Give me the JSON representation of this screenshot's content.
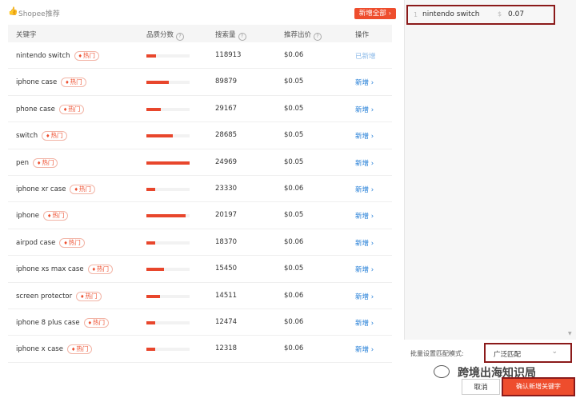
{
  "header": {
    "title": "Shopee推荐",
    "add_all_label": "新增全部",
    "add_all_chevron": "›"
  },
  "table": {
    "columns": [
      "关键字",
      "品质分数",
      "搜索量",
      "推荐出价",
      "操作"
    ],
    "hot_label": "热门",
    "rows": [
      {
        "keyword": "nintendo switch",
        "quality": 0.22,
        "volume": "118913",
        "bid": "$0.06",
        "action": "已新增",
        "added": true
      },
      {
        "keyword": "iphone case",
        "quality": 0.52,
        "volume": "89879",
        "bid": "$0.05",
        "action": "新增 ›",
        "added": false
      },
      {
        "keyword": "phone case",
        "quality": 0.33,
        "volume": "29167",
        "bid": "$0.05",
        "action": "新增 ›",
        "added": false
      },
      {
        "keyword": "switch",
        "quality": 0.62,
        "volume": "28685",
        "bid": "$0.05",
        "action": "新增 ›",
        "added": false
      },
      {
        "keyword": "pen",
        "quality": 1.0,
        "volume": "24969",
        "bid": "$0.05",
        "action": "新增 ›",
        "added": false
      },
      {
        "keyword": "iphone xr case",
        "quality": 0.2,
        "volume": "23330",
        "bid": "$0.06",
        "action": "新增 ›",
        "added": false
      },
      {
        "keyword": "iphone",
        "quality": 0.9,
        "volume": "20197",
        "bid": "$0.05",
        "action": "新增 ›",
        "added": false
      },
      {
        "keyword": "airpod case",
        "quality": 0.2,
        "volume": "18370",
        "bid": "$0.06",
        "action": "新增 ›",
        "added": false
      },
      {
        "keyword": "iphone xs max case",
        "quality": 0.4,
        "volume": "15450",
        "bid": "$0.05",
        "action": "新增 ›",
        "added": false
      },
      {
        "keyword": "screen protector",
        "quality": 0.32,
        "volume": "14511",
        "bid": "$0.06",
        "action": "新增 ›",
        "added": false
      },
      {
        "keyword": "iphone 8 plus case",
        "quality": 0.2,
        "volume": "12474",
        "bid": "$0.06",
        "action": "新增 ›",
        "added": false
      },
      {
        "keyword": "iphone x case",
        "quality": 0.2,
        "volume": "12318",
        "bid": "$0.06",
        "action": "新增 ›",
        "added": false
      }
    ]
  },
  "selected": {
    "index": "1",
    "keyword": "nintendo switch",
    "currency": "$",
    "bid": "0.07"
  },
  "batch": {
    "label": "批量设置匹配模式:",
    "value": "广泛匹配"
  },
  "watermark": {
    "text": "跨境出海知识局"
  },
  "buttons": {
    "cancel": "取消",
    "confirm": "确认新增关键字"
  },
  "colors": {
    "accent": "#ee4d2d",
    "link": "#1e7bd6",
    "highlight_border": "#8b1a1a"
  }
}
